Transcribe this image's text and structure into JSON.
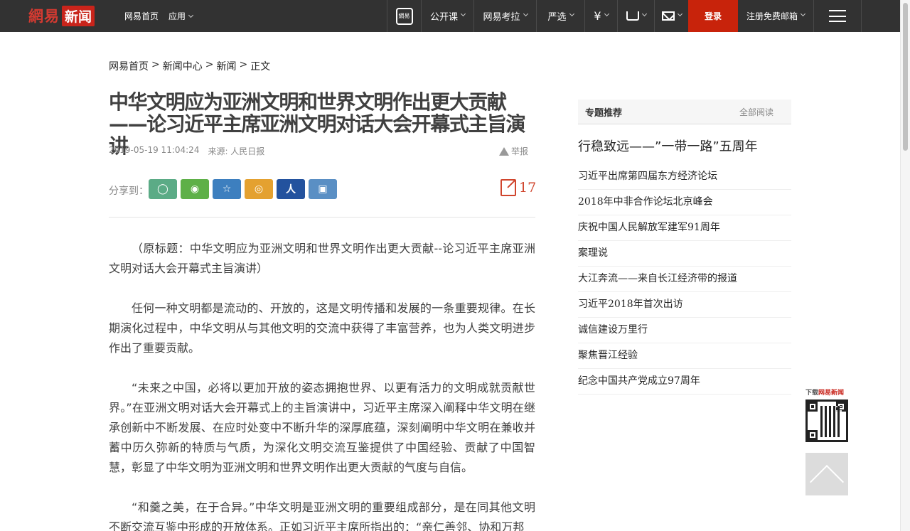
{
  "header": {
    "logo_part1": "網易",
    "logo_part2": "新闻",
    "nav_home": "网易首页",
    "nav_apps": "应用",
    "phone_label": "網易",
    "open_course": "公开课",
    "kaola": "网易考拉",
    "yanxuan": "严选",
    "yen": "¥",
    "login": "登录",
    "register": "注册免费邮箱"
  },
  "breadcrumb": [
    "网易首页",
    "新闻中心",
    "新闻",
    "正文"
  ],
  "breadcrumb_sep": ">",
  "article": {
    "title": "中华文明应为亚洲文明和世界文明作出更大贡献——论习近平主席亚洲文明对话大会开幕式主旨演讲",
    "datetime": "2019-05-19 11:04:24",
    "source": "来源: 人民日报",
    "report": "举报",
    "share_label": "分享到：",
    "comment_count": "17",
    "paragraphs": [
      "（原标题：中华文明应为亚洲文明和世界文明作出更大贡献--论习近平主席亚洲文明对话大会开幕式主旨演讲）",
      "任何一种文明都是流动的、开放的，这是文明传播和发展的一条重要规律。在长期演化过程中，中华文明从与其他文明的交流中获得了丰富营养，也为人类文明进步作出了重要贡献。",
      "“未来之中国，必将以更加开放的姿态拥抱世界、以更有活力的文明成就贡献世界。”在亚洲文明对话大会开幕式上的主旨演讲中，习近平主席深入阐释中华文明在继承创新中不断发展、在应时处变中不断升华的深厚底蕴，深刻阐明中华文明在兼收并蓄中历久弥新的特质与气质，为深化文明交流互鉴提供了中国经验、贡献了中国智慧，彰显了中华文明为亚洲文明和世界文明作出更大贡献的气度与自信。",
      "“和羹之美，在于合异。”中华文明是亚洲文明的重要组成部分，是在同其他文明不断交流互鉴中形成的开放体系。正如习近平主席所指出的：“亲仁善邻、协和万邦"
    ]
  },
  "sidebar": {
    "heading": "专题推荐",
    "all": "全部阅读",
    "topic_title": "行稳致远——”一带一路”五周年",
    "items": [
      "习近平出席第四届东方经济论坛",
      "2018年中非合作论坛北京峰会",
      "庆祝中国人民解放军建军91周年",
      "案理说",
      "大江奔流——来自长江经济带的报道",
      "习近平2018年首次出访",
      "诚信建设万里行",
      "聚焦晋江经验",
      "纪念中国共产党成立97周年"
    ]
  },
  "qr": {
    "label_pre": "下载",
    "label_red": "网易新闻"
  }
}
